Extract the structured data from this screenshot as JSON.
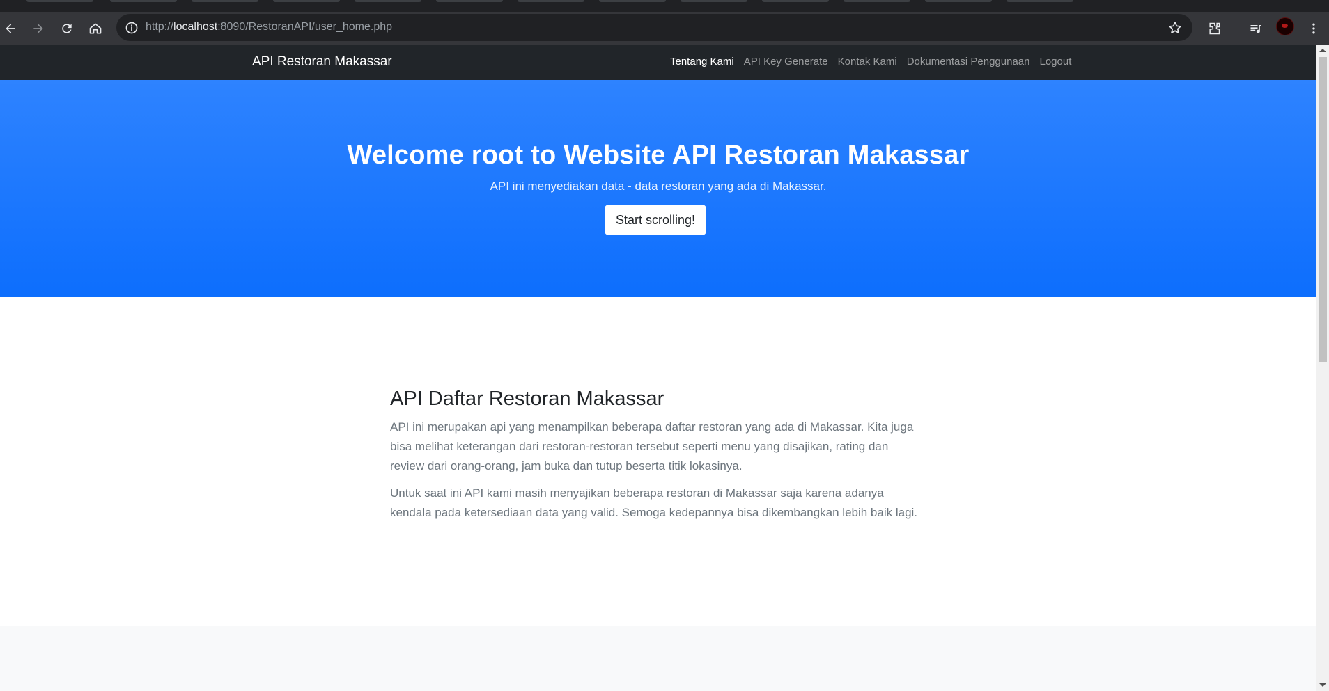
{
  "browser": {
    "url_prefix": "http://",
    "url_host": "localhost",
    "url_rest": ":8090/RestoranAPI/user_home.php",
    "icons": [
      "back-icon",
      "forward-icon",
      "reload-icon",
      "home-icon",
      "site-info-icon",
      "bookmark-star-icon",
      "extensions-icon",
      "media-control-icon",
      "menu-dots-icon"
    ]
  },
  "navbar": {
    "brand": "API Restoran Makassar",
    "links": [
      {
        "label": "Tentang Kami",
        "active": true
      },
      {
        "label": "API Key Generate",
        "active": false
      },
      {
        "label": "Kontak Kami",
        "active": false
      },
      {
        "label": "Dokumentasi Penggunaan",
        "active": false
      },
      {
        "label": "Logout",
        "active": false
      }
    ]
  },
  "hero": {
    "title": "Welcome root to Website API Restoran Makassar",
    "subtitle": "API ini menyediakan data - data restoran yang ada di Makassar.",
    "button": "Start scrolling!"
  },
  "about": {
    "heading": "API Daftar Restoran Makassar",
    "paragraph1": "API ini merupakan api yang menampilkan beberapa daftar restoran yang ada di Makassar. Kita juga bisa melihat keterangan dari restoran-restoran tersebut seperti menu yang disajikan, rating dan review dari orang-orang, jam buka dan tutup beserta titik lokasinya.",
    "paragraph2": "Untuk saat ini API kami masih menyajikan beberapa restoran di Makassar saja karena adanya kendala pada ketersediaan data yang valid. Semoga kedepannya bisa dikembangkan lebih baik lagi."
  },
  "colors": {
    "navbar_bg": "#212529",
    "hero_bg": "#0d6efd",
    "text_muted": "#6c757d"
  }
}
